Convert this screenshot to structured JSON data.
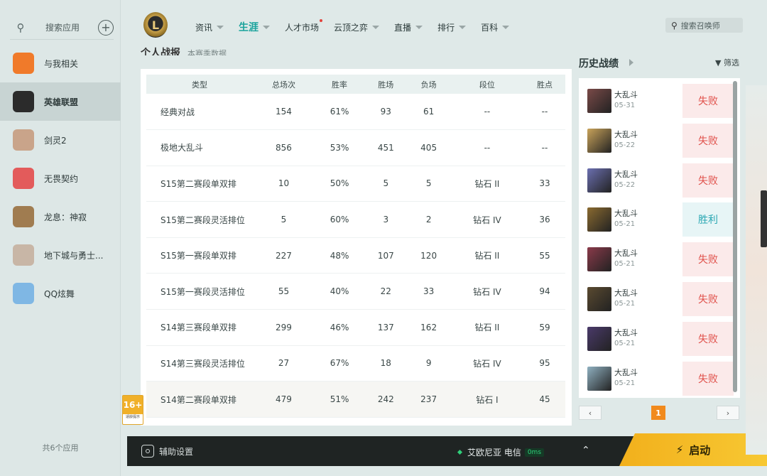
{
  "sidebar": {
    "search_placeholder": "搜索应用",
    "items": [
      {
        "label": "与我相关",
        "icon": "related-icon",
        "color": "#f07a2a"
      },
      {
        "label": "英雄联盟",
        "icon": "league-of-legends-icon",
        "color": "#2b2b2b"
      },
      {
        "label": "剑灵2",
        "icon": "blade-and-soul-icon",
        "color": "#c9a48a"
      },
      {
        "label": "无畏契约",
        "icon": "valorant-icon",
        "color": "#e35b5b"
      },
      {
        "label": "龙息：神寂",
        "icon": "dragon-breath-icon",
        "color": "#a07c50"
      },
      {
        "label": "地下城与勇士...",
        "icon": "dnf-icon",
        "color": "#c8b6a6"
      },
      {
        "label": "QQ炫舞",
        "icon": "qq-dance-icon",
        "color": "#7fb7e4"
      }
    ],
    "footer": "共6个应用"
  },
  "nav": {
    "tabs": [
      {
        "label": "资讯",
        "caret": true
      },
      {
        "label": "生涯",
        "caret": true,
        "active": true
      },
      {
        "label": "人才市场",
        "caret": false,
        "dot": true
      },
      {
        "label": "云顶之弈",
        "caret": true
      },
      {
        "label": "直播",
        "caret": true
      },
      {
        "label": "排行",
        "caret": true
      },
      {
        "label": "百科",
        "caret": true
      }
    ],
    "search_placeholder": "搜索召唤师"
  },
  "stats": {
    "title": "个人战报",
    "subtitle": "本赛季数据",
    "headers": [
      "类型",
      "总场次",
      "胜率",
      "胜场",
      "负场",
      "段位",
      "胜点"
    ],
    "rows": [
      [
        "经典对战",
        "154",
        "61%",
        "93",
        "61",
        "--",
        "--"
      ],
      [
        "极地大乱斗",
        "856",
        "53%",
        "451",
        "405",
        "--",
        "--"
      ],
      [
        "S15第二赛段单双排",
        "10",
        "50%",
        "5",
        "5",
        "钻石 II",
        "33"
      ],
      [
        "S15第二赛段灵活排位",
        "5",
        "60%",
        "3",
        "2",
        "钻石 IV",
        "36"
      ],
      [
        "S15第一赛段单双排",
        "227",
        "48%",
        "107",
        "120",
        "钻石 II",
        "55"
      ],
      [
        "S15第一赛段灵活排位",
        "55",
        "40%",
        "22",
        "33",
        "钻石 IV",
        "94"
      ],
      [
        "S14第三赛段单双排",
        "299",
        "46%",
        "137",
        "162",
        "钻石 II",
        "59"
      ],
      [
        "S14第三赛段灵活排位",
        "27",
        "67%",
        "18",
        "9",
        "钻石 IV",
        "95"
      ],
      [
        "S14第二赛段单双排",
        "479",
        "51%",
        "242",
        "237",
        "钻石 I",
        "45"
      ]
    ]
  },
  "age_badge": {
    "rating": "16+",
    "text": "适龄提示"
  },
  "history": {
    "title": "历史战绩",
    "filter": "筛选",
    "items": [
      {
        "mode": "大乱斗",
        "date": "05-31",
        "result": "失败",
        "win": false,
        "color": "#7a4a48"
      },
      {
        "mode": "大乱斗",
        "date": "05-22",
        "result": "失败",
        "win": false,
        "color": "#c9a35a"
      },
      {
        "mode": "大乱斗",
        "date": "05-22",
        "result": "失败",
        "win": false,
        "color": "#6b6fb0"
      },
      {
        "mode": "大乱斗",
        "date": "05-21",
        "result": "胜利",
        "win": true,
        "color": "#8a6a30"
      },
      {
        "mode": "大乱斗",
        "date": "05-21",
        "result": "失败",
        "win": false,
        "color": "#8a3a4a"
      },
      {
        "mode": "大乱斗",
        "date": "05-21",
        "result": "失败",
        "win": false,
        "color": "#5a4a30"
      },
      {
        "mode": "大乱斗",
        "date": "05-21",
        "result": "失败",
        "win": false,
        "color": "#4a3a6a"
      },
      {
        "mode": "大乱斗",
        "date": "05-21",
        "result": "失败",
        "win": false,
        "color": "#8fb0c0"
      }
    ],
    "page": "1",
    "prev": "‹",
    "next": "›"
  },
  "bottom": {
    "assist_label": "辅助设置",
    "server": "艾欧尼亚 电信",
    "ping": "0ms",
    "launch_label": "启动"
  }
}
